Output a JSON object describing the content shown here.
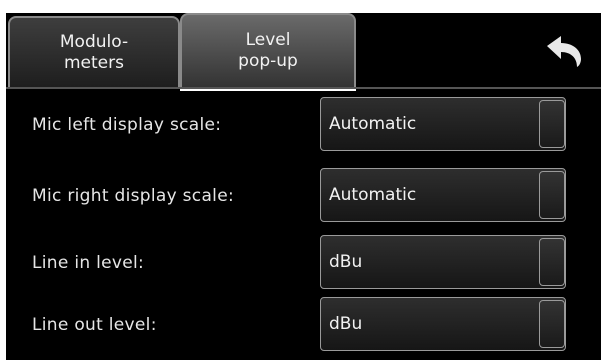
{
  "tabs": [
    {
      "label": "Modulo-\nmeters",
      "active": false
    },
    {
      "label": "Level\npop-up",
      "active": true
    }
  ],
  "toolbar": {
    "back_icon": "undo-arrow-icon"
  },
  "settings": [
    {
      "label": "Mic left display scale:",
      "value": "Automatic"
    },
    {
      "label": "Mic right display scale:",
      "value": "Automatic"
    },
    {
      "label": "Line in level:",
      "value": "dBu"
    },
    {
      "label": "Line out level:",
      "value": "dBu"
    }
  ],
  "colors": {
    "background": "#000000",
    "text": "#e6e6e6",
    "active_tab_underline": "#ffffff",
    "border": "#9a9a9a"
  }
}
